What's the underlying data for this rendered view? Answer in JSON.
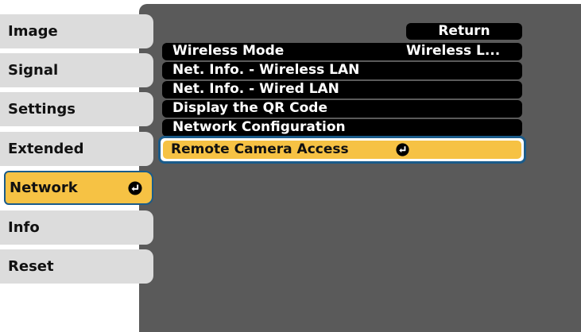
{
  "sidebar": {
    "items": [
      {
        "label": "Image",
        "active": false
      },
      {
        "label": "Signal",
        "active": false
      },
      {
        "label": "Settings",
        "active": false
      },
      {
        "label": "Extended",
        "active": false
      },
      {
        "label": "Network",
        "active": true,
        "icon": "enter-icon"
      },
      {
        "label": "Info",
        "active": false
      },
      {
        "label": "Reset",
        "active": false
      }
    ]
  },
  "panel": {
    "return_label": "Return",
    "rows": [
      {
        "label": "Wireless Mode",
        "value": "Wireless L..."
      },
      {
        "label": "Net. Info. - Wireless LAN",
        "value": ""
      },
      {
        "label": "Net. Info. - Wired LAN",
        "value": ""
      },
      {
        "label": "Display the QR Code",
        "value": ""
      },
      {
        "label": "Network Configuration",
        "value": ""
      }
    ],
    "selected": {
      "label": "Remote Camera Access",
      "icon": "enter-icon"
    }
  },
  "colors": {
    "highlight": "#f6c244",
    "selection_border": "#1a5b8a",
    "panel_bg": "#5a5a5a",
    "sidebar_bg": "#dcdcdc"
  }
}
